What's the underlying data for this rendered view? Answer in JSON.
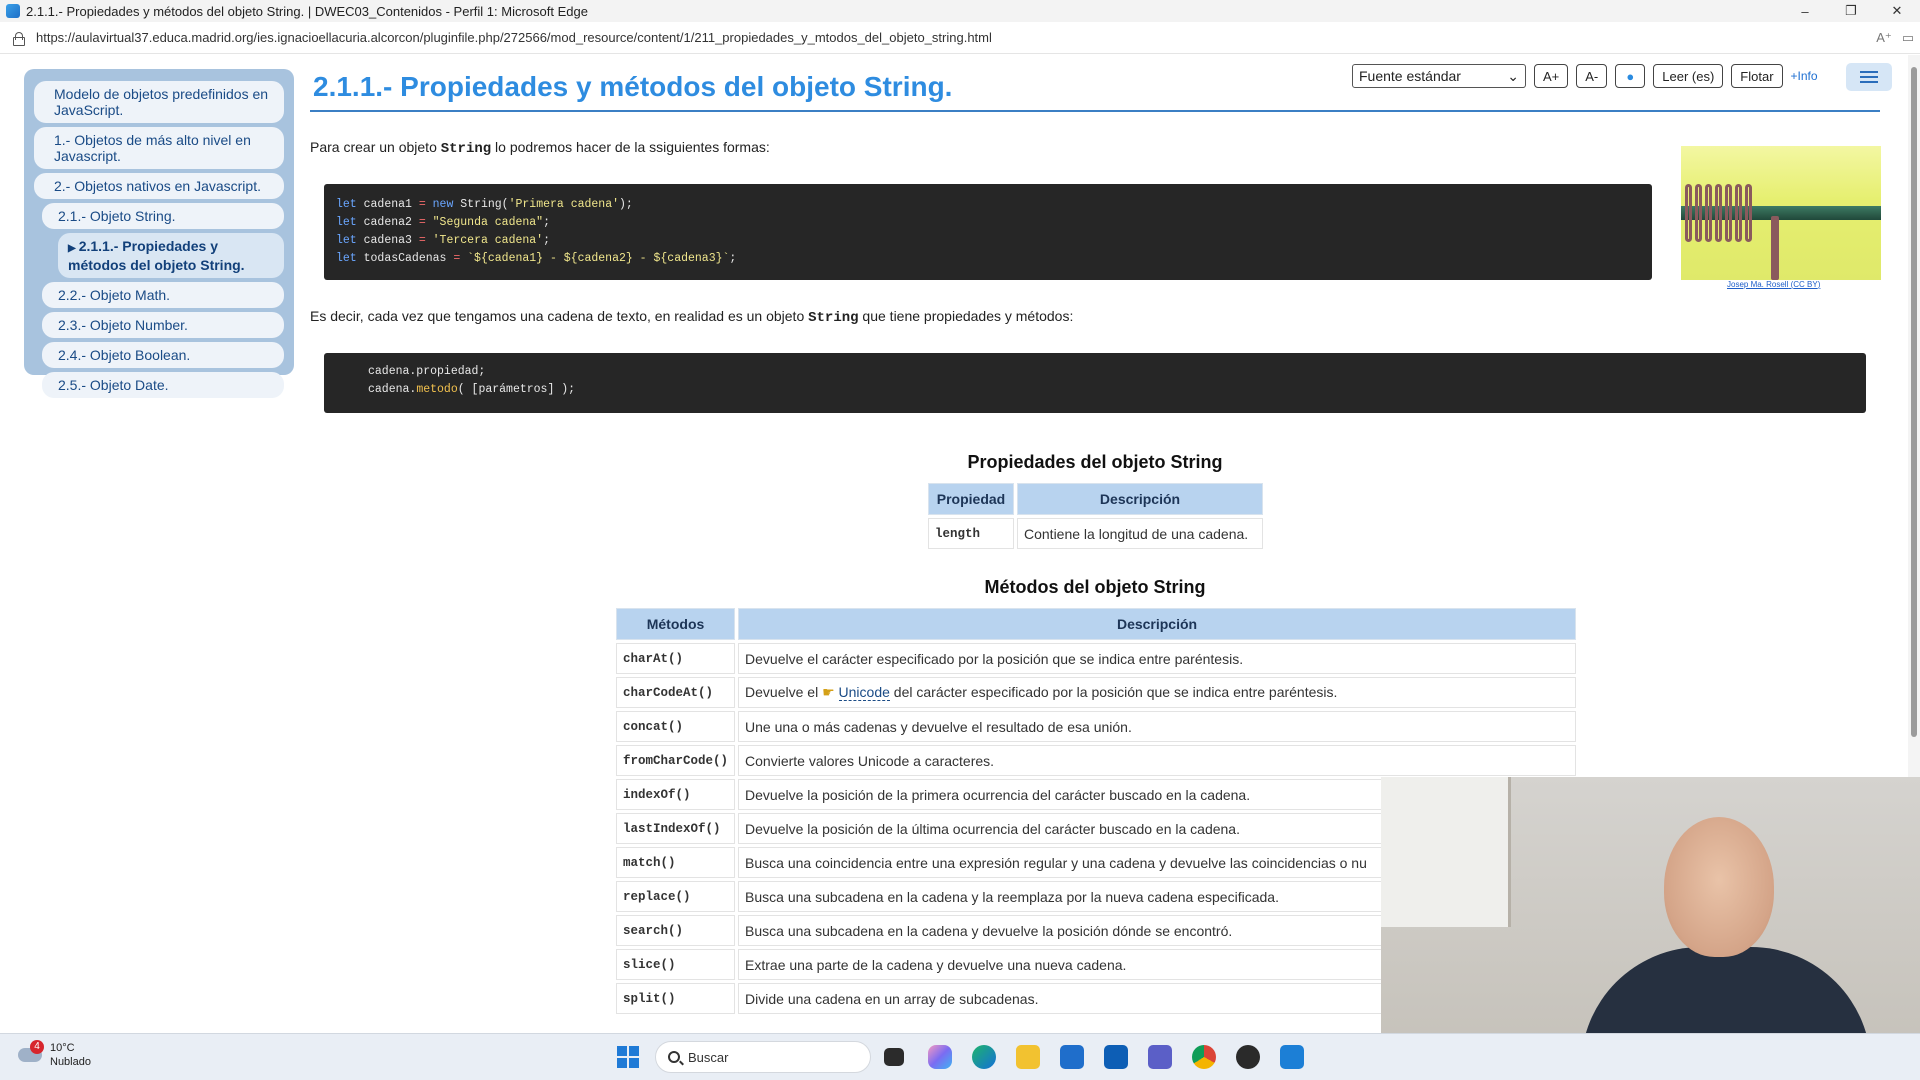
{
  "window": {
    "title": "2.1.1.- Propiedades y métodos del objeto String. | DWEC03_Contenidos - Perfil 1: Microsoft Edge",
    "url": "https://aulavirtual37.educa.madrid.org/ies.ignacioellacuria.alcorcon/pluginfile.php/272566/mod_resource/content/1/211_propiedades_y_mtodos_del_objeto_string.html"
  },
  "sidebar": {
    "items": [
      {
        "label": "Modelo de objetos predefinidos en JavaScript."
      },
      {
        "label": "1.- Objetos de más alto nivel en Javascript."
      },
      {
        "label": "2.- Objetos nativos en Javascript."
      },
      {
        "label": "2.1.- Objeto String."
      },
      {
        "label": "2.1.1.- Propiedades y métodos del objeto String."
      },
      {
        "label": "2.2.- Objeto Math."
      },
      {
        "label": "2.3.- Objeto Number."
      },
      {
        "label": "2.4.- Objeto Boolean."
      },
      {
        "label": "2.5.- Objeto Date."
      }
    ]
  },
  "toolbar": {
    "font_select": "Fuente estándar",
    "a_plus": "A+",
    "a_minus": "A-",
    "read": "Leer (es)",
    "float": "Flotar",
    "info": "+Info"
  },
  "content": {
    "title": "2.1.1.- Propiedades y métodos del objeto String.",
    "intro_before": "Para crear un objeto ",
    "intro_code": "String",
    "intro_after": " lo podremos hacer de la ssiguientes formas:",
    "code1": [
      [
        "let",
        " cadena1 ",
        "=",
        " ",
        "new",
        " String(",
        "'Primera cadena'",
        ");"
      ],
      [
        "let",
        " cadena2 ",
        "=",
        " ",
        "",
        "",
        "\"Segunda cadena\"",
        ";"
      ],
      [
        "let",
        " cadena3 ",
        "=",
        " ",
        "",
        "",
        "'Tercera cadena'",
        ";"
      ],
      [
        "let",
        " todasCadenas ",
        "=",
        " ",
        "",
        "",
        "`${cadena1} - ${cadena2} - ${cadena3}`",
        ";"
      ]
    ],
    "para2_before": "Es decir, cada vez que tengamos una cadena de texto, en realidad es un objeto ",
    "para2_code": "String",
    "para2_after": " que tiene propiedades y métodos:",
    "code2_line1": "cadena.propiedad;",
    "code2_line2_a": "cadena.",
    "code2_line2_fn": "metodo",
    "code2_line2_b": "( [parámetros] );",
    "photo_credit_author": "Josep Ma. Rosell",
    "photo_credit_license": "CC BY",
    "props_title": "Propiedades del objeto String",
    "props_headers": [
      "Propiedad",
      "Descripción"
    ],
    "props_rows": [
      [
        "length",
        "Contiene la longitud de una cadena."
      ]
    ],
    "methods_title": "Métodos del objeto String",
    "methods_headers": [
      "Métodos",
      "Descripción"
    ],
    "methods_rows": [
      [
        "charAt()",
        "Devuelve el carácter especificado por la posición que se indica entre paréntesis."
      ],
      [
        "charCodeAt()",
        "Devuelve el  Unicode del carácter especificado por la posición que se indica entre paréntesis."
      ],
      [
        "concat()",
        "Une una o más cadenas y devuelve el resultado de esa unión."
      ],
      [
        "fromCharCode()",
        "Convierte valores Unicode a caracteres."
      ],
      [
        "indexOf()",
        "Devuelve la posición de la primera ocurrencia del carácter buscado en la cadena."
      ],
      [
        "lastIndexOf()",
        "Devuelve la posición de la última ocurrencia del carácter buscado en la cadena."
      ],
      [
        "match()",
        "Busca una coincidencia entre una expresión regular y una cadena y devuelve las coincidencias o nu"
      ],
      [
        "replace()",
        "Busca una subcadena en la cadena y la reemplaza por la nueva cadena especificada."
      ],
      [
        "search()",
        "Busca una subcadena en la cadena y devuelve la posición dónde se encontró."
      ],
      [
        "slice()",
        "Extrae una parte de la cadena y devuelve una nueva cadena."
      ],
      [
        "split()",
        "Divide una cadena en un array de subcadenas."
      ]
    ]
  },
  "taskbar": {
    "temp": "10°C",
    "condition": "Nublado",
    "badge": "4",
    "search_placeholder": "Buscar"
  }
}
